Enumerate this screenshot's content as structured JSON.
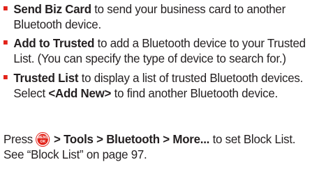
{
  "bullets": [
    {
      "term": "Send Biz Card",
      "text_before_link": " to send your business card to another Bluetooth device.",
      "link": "",
      "text_after_link": ""
    },
    {
      "term": "Add to Trusted",
      "text_before_link": " to add a Bluetooth device to your Trusted List. (You can specify the type of device to search for.)",
      "link": "",
      "text_after_link": ""
    },
    {
      "term": "Trusted List",
      "text_before_link": " to display a list of trusted Bluetooth devices. Select ",
      "link": "<Add New>",
      "text_after_link": " to find another Bluetooth device."
    }
  ],
  "press": {
    "prefix": "Press ",
    "key_icon": "menu-ok-key-icon",
    "key_line1": "MENU",
    "key_line2": "OK",
    "path": " > Tools > Bluetooth > More...",
    "suffix": " to set Block List. See “Block List” on page 97."
  },
  "colors": {
    "accent": "#e2231a",
    "text": "#231f20"
  }
}
